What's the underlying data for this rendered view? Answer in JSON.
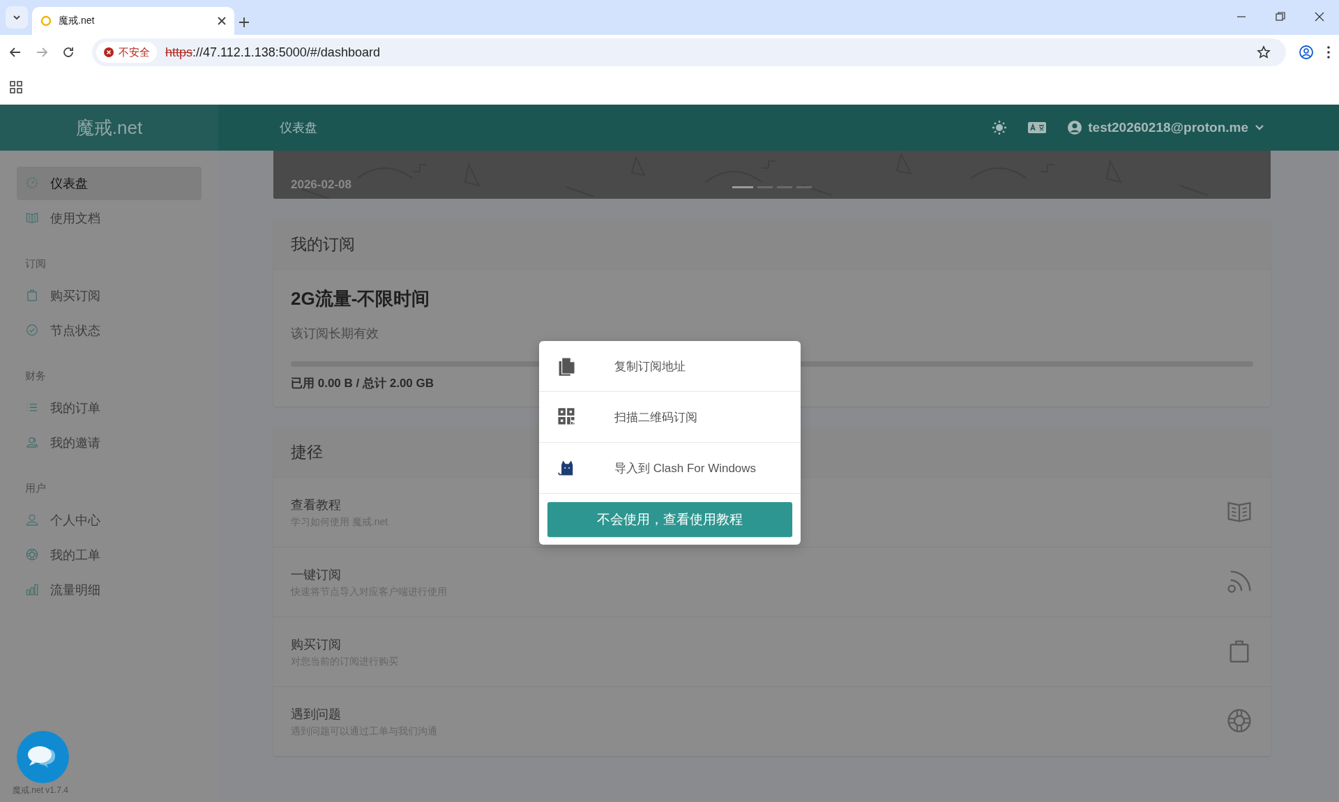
{
  "browser": {
    "tab_title": "魔戒.net",
    "security_label": "不安全",
    "url_scheme": "https",
    "url_rest": "://47.112.1.138:5000/#/dashboard"
  },
  "header": {
    "logo": "魔戒.net",
    "page_title": "仪表盘",
    "user": "test20260218@proton.me"
  },
  "sidebar": {
    "groups": [
      {
        "items": [
          {
            "label": "仪表盘",
            "selected": true
          },
          {
            "label": "使用文档",
            "selected": false
          }
        ]
      },
      {
        "title": "订阅",
        "items": [
          {
            "label": "购买订阅",
            "selected": false
          },
          {
            "label": "节点状态",
            "selected": false
          }
        ]
      },
      {
        "title": "财务",
        "items": [
          {
            "label": "我的订单",
            "selected": false
          },
          {
            "label": "我的邀请",
            "selected": false
          }
        ]
      },
      {
        "title": "用户",
        "items": [
          {
            "label": "个人中心",
            "selected": false
          },
          {
            "label": "我的工单",
            "selected": false
          },
          {
            "label": "流量明细",
            "selected": false
          }
        ]
      }
    ],
    "version": "魔戒.net v1.7.4"
  },
  "banner": {
    "date": "2026-02-08",
    "dots": [
      {
        "selected": true
      },
      {
        "selected": false
      },
      {
        "selected": false
      },
      {
        "selected": false
      }
    ]
  },
  "subscription": {
    "title": "我的订阅",
    "plan": "2G流量-不限时间",
    "validity": "该订阅长期有效",
    "level": 0,
    "usage": "已用 0.00 B / 总计 2.00 GB"
  },
  "shortcuts": {
    "title": "捷径",
    "items": [
      {
        "title": "查看教程",
        "description": "学习如何使用 魔戒.net"
      },
      {
        "title": "一键订阅",
        "description": "快速将节点导入对应客户端进行使用"
      },
      {
        "title": "购买订阅",
        "description": "对您当前的订阅进行购买"
      },
      {
        "title": "遇到问题",
        "description": "遇到问题可以通过工单与我们沟通"
      }
    ]
  },
  "modal": {
    "options": [
      {
        "label": "复制订阅地址"
      },
      {
        "label": "扫描二维码订阅"
      },
      {
        "label": "导入到 Clash For Windows"
      }
    ],
    "button": "不会使用，查看使用教程"
  }
}
